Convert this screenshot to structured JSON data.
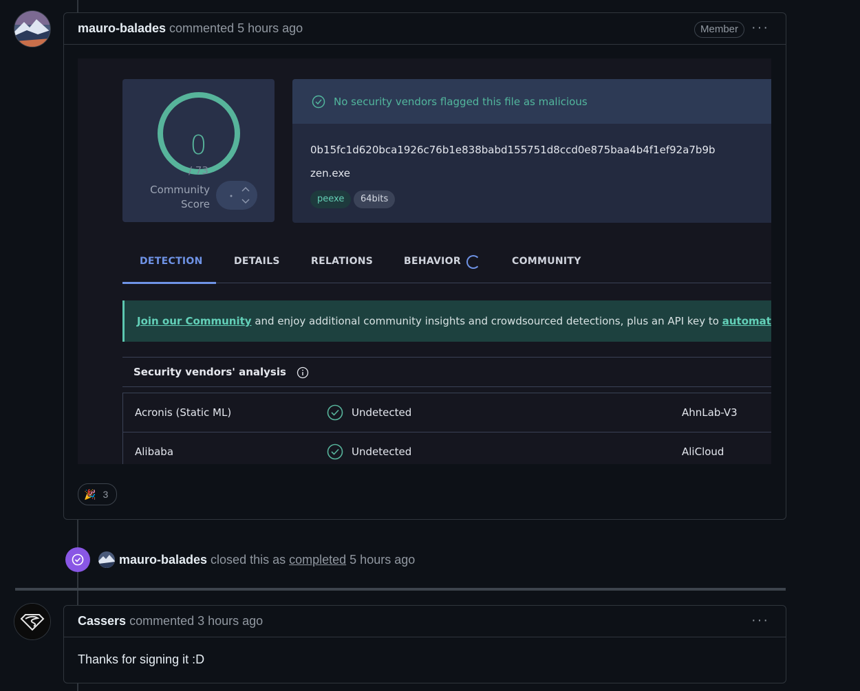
{
  "comment1": {
    "author": "mauro-balades",
    "action": "commented",
    "timestamp": "5 hours ago",
    "role_badge": "Member",
    "menu_label": "···"
  },
  "virustotal": {
    "score": "0",
    "score_total": "/ 73",
    "community_score_label": "Community Score",
    "status_message": "No security vendors flagged this file as malicious",
    "hash": "0b15fc1d620bca1926c76b1e838babd155751d8ccd0e875baa4b4f1ef92a7b9b",
    "filename": "zen.exe",
    "tags": [
      "peexe",
      "64bits"
    ],
    "tabs": [
      "DETECTION",
      "DETAILS",
      "RELATIONS",
      "BEHAVIOR",
      "COMMUNITY"
    ],
    "banner": {
      "link1": "Join our Community",
      "text": " and enjoy additional community insights and crowdsourced detections, plus an API key to ",
      "link2": "automate checks."
    },
    "analysis_header": "Security vendors' analysis",
    "rows": [
      {
        "vendor": "Acronis (Static ML)",
        "status": "Undetected",
        "vendor2": "AhnLab-V3"
      },
      {
        "vendor": "Alibaba",
        "status": "Undetected",
        "vendor2": "AliCloud"
      }
    ]
  },
  "reaction": {
    "emoji": "🎉",
    "count": "3"
  },
  "event": {
    "author": "mauro-balades",
    "text_before": "closed this as",
    "link": "completed",
    "timestamp": "5 hours ago"
  },
  "comment2": {
    "author": "Cassers",
    "action": "commented",
    "timestamp": "3 hours ago",
    "menu_label": "···",
    "body": "Thanks for signing it :D"
  },
  "colors": {
    "background": "#0d1117",
    "border": "#30363d",
    "closed_badge": "#8957e5",
    "vt_green": "#57b49b",
    "vt_blue": "#6f93e6"
  }
}
